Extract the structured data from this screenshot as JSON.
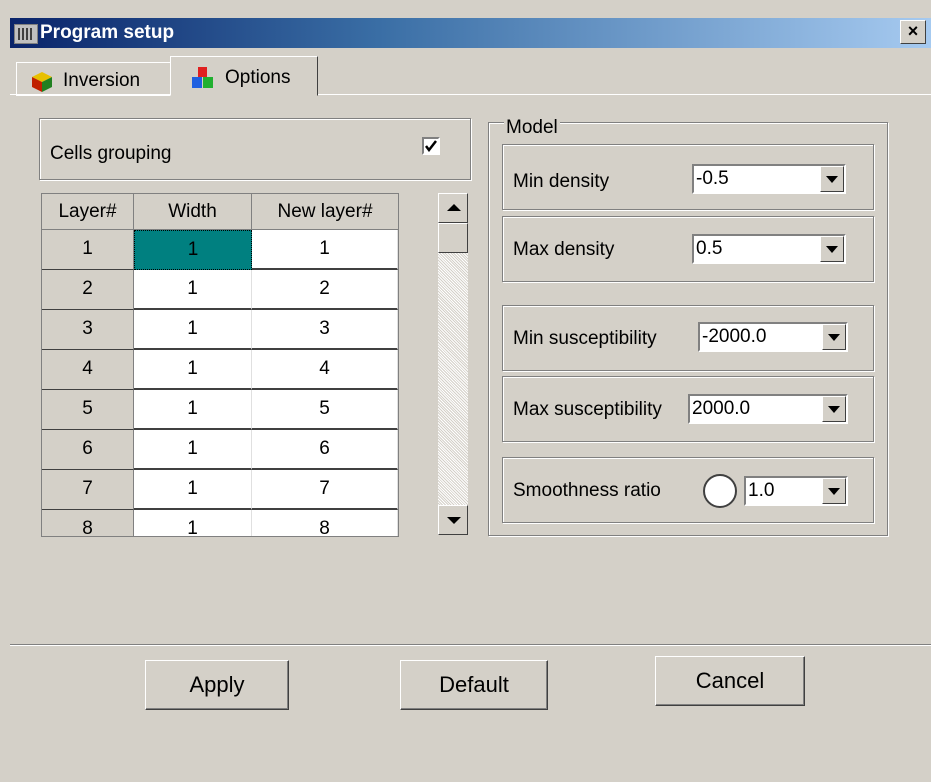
{
  "window": {
    "title": "Program setup",
    "close_label": "×"
  },
  "tabs": [
    {
      "label": "Inversion",
      "active": false
    },
    {
      "label": "Options",
      "active": true
    }
  ],
  "cells_grouping": {
    "label": "Cells grouping",
    "checked": true
  },
  "layer_table": {
    "columns": [
      "Layer#",
      "Width",
      "New layer#"
    ],
    "rows": [
      [
        "1",
        "1",
        "1"
      ],
      [
        "2",
        "1",
        "2"
      ],
      [
        "3",
        "1",
        "3"
      ],
      [
        "4",
        "1",
        "4"
      ],
      [
        "5",
        "1",
        "5"
      ],
      [
        "6",
        "1",
        "6"
      ],
      [
        "7",
        "1",
        "7"
      ],
      [
        "8",
        "1",
        "8"
      ]
    ]
  },
  "model": {
    "title": "Model",
    "min_density": {
      "label": "Min density",
      "value": "-0.5"
    },
    "max_density": {
      "label": "Max density",
      "value": "0.5"
    },
    "min_susceptibility": {
      "label": "Min susceptibility",
      "value": "-2000.0"
    },
    "max_susceptibility": {
      "label": "Max susceptibility",
      "value": "2000.0"
    },
    "smoothness_ratio": {
      "label": "Smoothness ratio",
      "value": "1.0"
    }
  },
  "buttons": {
    "apply": "Apply",
    "default": "Default",
    "cancel": "Cancel"
  },
  "colors": {
    "title_start": "#0a246a",
    "title_end": "#a6caf0",
    "selected_cell": "#008080",
    "face": "#d4d0c8"
  }
}
